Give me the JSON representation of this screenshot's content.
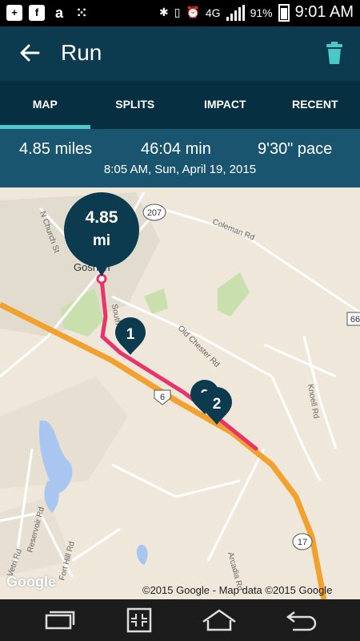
{
  "status_bar": {
    "battery": "91%",
    "time": "9:01 AM",
    "network": "4G",
    "left_icons": [
      "plus-icon",
      "facebook-icon",
      "amazon-icon",
      "dots-icon"
    ],
    "right_icons": [
      "bluetooth-icon",
      "phone-icon",
      "alarm-icon",
      "network-icon",
      "signal-icon",
      "battery-icon"
    ]
  },
  "app_bar": {
    "title": "Run"
  },
  "tabs": [
    {
      "label": "MAP",
      "active": true
    },
    {
      "label": "SPLITS",
      "active": false
    },
    {
      "label": "IMPACT",
      "active": false
    },
    {
      "label": "RECENT",
      "active": false
    }
  ],
  "stats": {
    "distance": "4.85 miles",
    "duration": "46:04 min",
    "pace": "9'30\" pace",
    "datetime": "8:05 AM, Sun, April 19, 2015"
  },
  "map": {
    "total_pin_value": "4.85",
    "total_pin_unit": "mi",
    "markers": [
      "1",
      "?",
      "2"
    ],
    "town_label": "Goshen",
    "road_labels": {
      "route_207": "207",
      "route_66": "66",
      "route_6": "6",
      "route_17": "17",
      "coleman_rd": "Coleman Rd",
      "n_church_st": "N Church St",
      "south_st": "South St",
      "old_chester_rd": "Old Chester Rd",
      "knoell_rd": "Knoell Rd",
      "arcadia_rd": "Arcadia Rd",
      "reservoir_rd": "Reservoir Rd",
      "fort_hill_rd": "Fort Hill Rd",
      "vetri_rd": "Vetri Rd"
    },
    "copyright": "©2015 Google - Map data ©2015 Google",
    "logo": "Google"
  },
  "colors": {
    "app_bar": "#0c3a4e",
    "tab_bar": "#062f42",
    "stats_bar": "#1a5570",
    "accent": "#4bc8c8",
    "route": "#e8336b",
    "highway": "#f2a12e"
  },
  "nav_bar": {
    "buttons": [
      "recent-apps-icon",
      "multiwindow-icon",
      "home-icon",
      "back-icon"
    ]
  }
}
